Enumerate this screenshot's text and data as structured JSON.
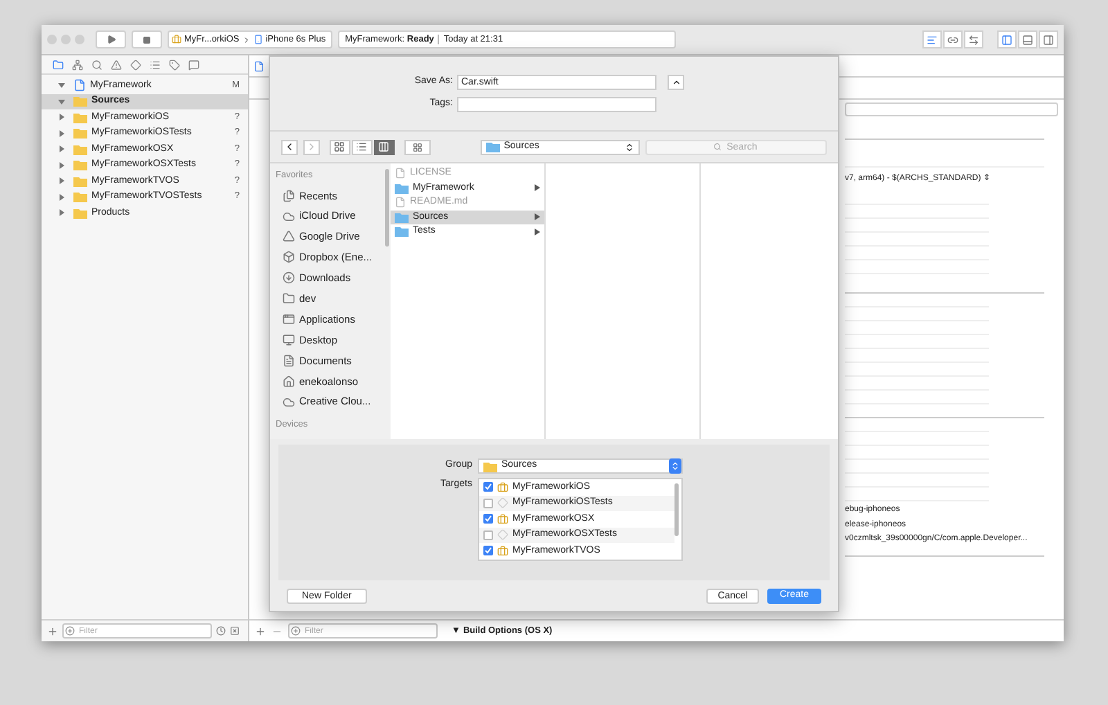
{
  "toolbar": {
    "scheme": "MyFr...orkiOS",
    "device": "iPhone 6s Plus",
    "status_project": "MyFramework:",
    "status_state": "Ready",
    "status_time": "Today at 21:31",
    "editor_modes": [
      {
        "kind": "standard",
        "selected": true
      },
      {
        "kind": "assistant",
        "selected": false
      },
      {
        "kind": "version",
        "selected": false
      }
    ],
    "panels": [
      {
        "kind": "navigator",
        "selected": true
      },
      {
        "kind": "debug",
        "selected": false
      },
      {
        "kind": "utilities",
        "selected": false
      }
    ]
  },
  "navigator": {
    "tabs": [
      {
        "kind": "project",
        "selected": true
      },
      {
        "kind": "symbol",
        "selected": false
      },
      {
        "kind": "find",
        "selected": false
      },
      {
        "kind": "issue",
        "selected": false
      },
      {
        "kind": "test",
        "selected": false
      },
      {
        "kind": "debug",
        "selected": false
      },
      {
        "kind": "breakpoint",
        "selected": false
      },
      {
        "kind": "report",
        "selected": false
      }
    ],
    "tree": [
      {
        "label": "MyFramework",
        "kind": "project",
        "badge": "M",
        "expanded": true,
        "selected": false,
        "children": [
          {
            "label": "Sources",
            "kind": "group",
            "expanded": true,
            "selected": true
          },
          {
            "label": "MyFrameworkiOS",
            "kind": "group",
            "badge": "?",
            "expanded": false,
            "selected": false
          },
          {
            "label": "MyFrameworkiOSTests",
            "kind": "group",
            "badge": "?",
            "expanded": false,
            "selected": false
          },
          {
            "label": "MyFrameworkOSX",
            "kind": "group",
            "badge": "?",
            "expanded": false,
            "selected": false
          },
          {
            "label": "MyFrameworkOSXTests",
            "kind": "group",
            "badge": "?",
            "expanded": false,
            "selected": false
          },
          {
            "label": "MyFrameworkTVOS",
            "kind": "group",
            "badge": "?",
            "expanded": false,
            "selected": false
          },
          {
            "label": "MyFrameworkTVOSTests",
            "kind": "group",
            "badge": "?",
            "expanded": false,
            "selected": false
          },
          {
            "label": "Products",
            "kind": "group",
            "expanded": false,
            "selected": false
          }
        ]
      }
    ],
    "filter_placeholder": "Filter"
  },
  "editor": {
    "archs": "v7, arm64)  -  $(ARCHS_STANDARD) ⇕",
    "paths": [
      "ebug-iphoneos",
      "elease-iphoneos",
      "v0czmltsk_39s00000gn/C/com.apple.Developer..."
    ],
    "section": "Build Options (OS X)",
    "section_marker": "▼",
    "filter_placeholder": "Filter"
  },
  "dialog": {
    "save_as_label": "Save As:",
    "save_as_value": "Car.swift",
    "tags_label": "Tags:",
    "view_modes": [
      {
        "kind": "icons",
        "selected": false
      },
      {
        "kind": "list",
        "selected": false
      },
      {
        "kind": "columns",
        "selected": true
      }
    ],
    "location": "Sources",
    "search_placeholder": "Search",
    "sidebar": {
      "favorites": "Favorites",
      "items": [
        {
          "label": "Recents",
          "kind": "recents"
        },
        {
          "label": "iCloud Drive",
          "kind": "cloud"
        },
        {
          "label": "Google Drive",
          "kind": "drive"
        },
        {
          "label": "Dropbox (Ene...",
          "kind": "dropbox"
        },
        {
          "label": "Downloads",
          "kind": "downloads"
        },
        {
          "label": "dev",
          "kind": "folder"
        },
        {
          "label": "Applications",
          "kind": "apps"
        },
        {
          "label": "Desktop",
          "kind": "desktop"
        },
        {
          "label": "Documents",
          "kind": "documents"
        },
        {
          "label": "enekoalonso",
          "kind": "home"
        },
        {
          "label": "Creative Clou...",
          "kind": "creative"
        }
      ],
      "devices": "Devices"
    },
    "files": [
      {
        "label": "LICENSE",
        "kind": "file",
        "disabled": true,
        "selected": false
      },
      {
        "label": "MyFramework",
        "kind": "folder",
        "disabled": false,
        "selected": false
      },
      {
        "label": "README.md",
        "kind": "file",
        "disabled": true,
        "selected": false
      },
      {
        "label": "Sources",
        "kind": "folder",
        "disabled": false,
        "selected": true
      },
      {
        "label": "Tests",
        "kind": "folder",
        "disabled": false,
        "selected": false
      }
    ],
    "group_label": "Group",
    "group_value": "Sources",
    "targets_label": "Targets",
    "targets": [
      {
        "label": "MyFrameworkiOS",
        "kind": "framework",
        "checked": true
      },
      {
        "label": "MyFrameworkiOSTests",
        "kind": "tests",
        "checked": false
      },
      {
        "label": "MyFrameworkOSX",
        "kind": "framework",
        "checked": true
      },
      {
        "label": "MyFrameworkOSXTests",
        "kind": "tests",
        "checked": false
      },
      {
        "label": "MyFrameworkTVOS",
        "kind": "framework",
        "checked": true
      }
    ],
    "new_folder": "New Folder",
    "cancel": "Cancel",
    "create": "Create"
  }
}
